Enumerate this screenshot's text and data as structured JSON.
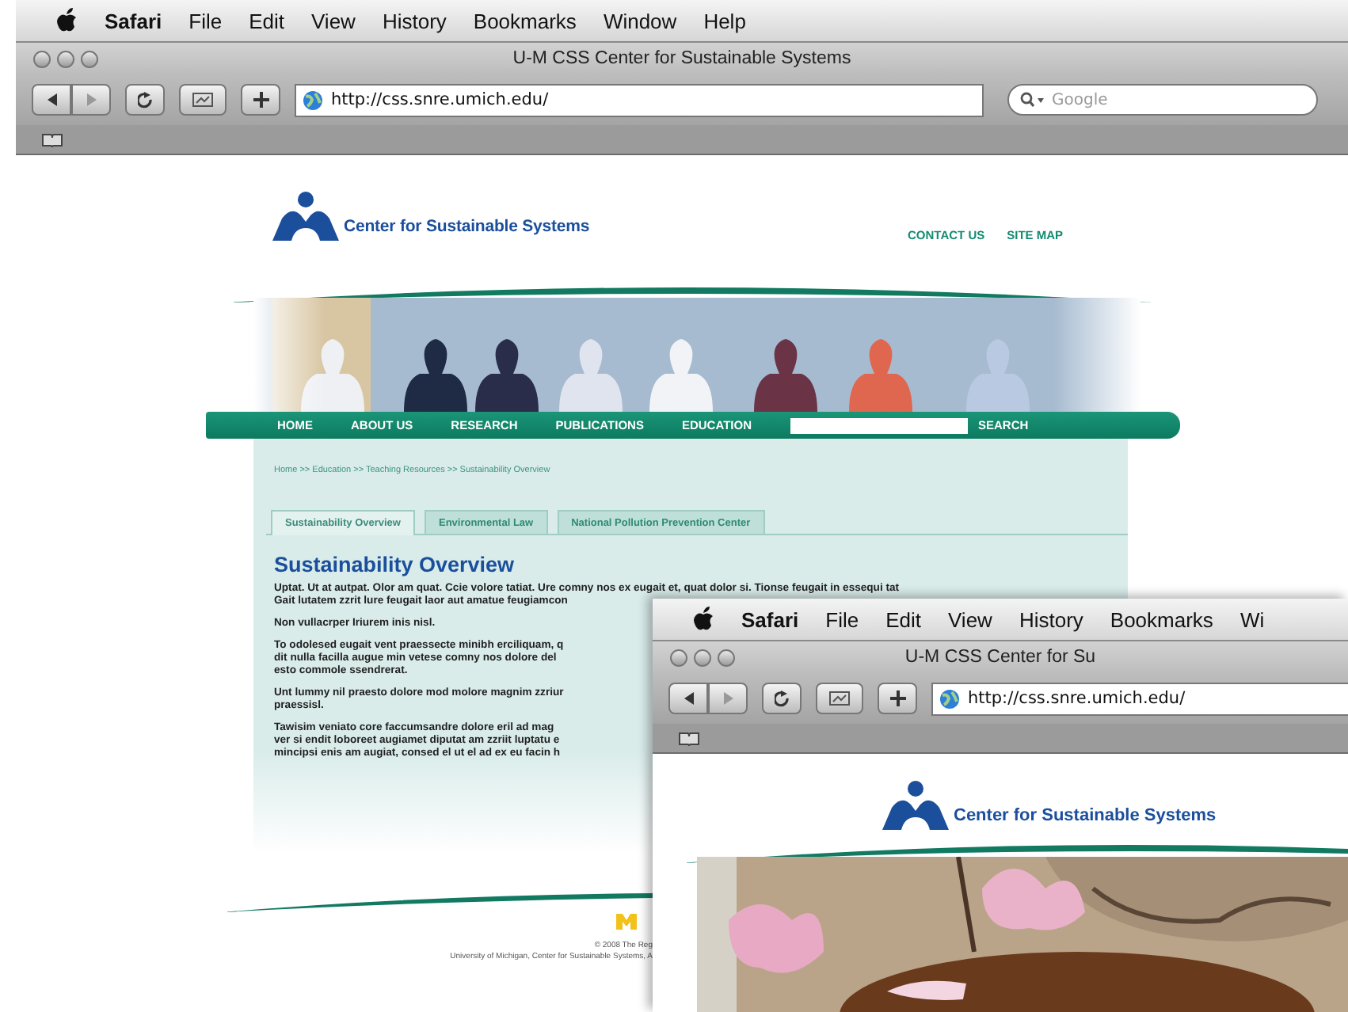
{
  "menu_bar": {
    "items": [
      "Safari",
      "File",
      "Edit",
      "View",
      "History",
      "Bookmarks",
      "Window",
      "Help"
    ]
  },
  "window": {
    "title": "U-M CSS Center for Sustainable Systems",
    "url": "http://css.snre.umich.edu/",
    "search": {
      "placeholder": "Google"
    }
  },
  "page": {
    "logo_text": "Center for Sustainable Systems",
    "top_links": [
      "CONTACT US",
      "SITE MAP"
    ],
    "nav": [
      "HOME",
      "ABOUT US",
      "RESEARCH",
      "PUBLICATIONS",
      "EDUCATION"
    ],
    "search_button": "SEARCH",
    "breadcrumb": "Home >> Education >> Teaching Resources >> Sustainability Overview",
    "tabs": [
      {
        "label": "Sustainability Overview",
        "selected": true
      },
      {
        "label": "Environmental Law",
        "selected": false
      },
      {
        "label": "National Pollution Prevention Center",
        "selected": false
      }
    ],
    "heading": "Sustainability Overview",
    "paragraphs": [
      [
        "Uptat. Ut at autpat. Olor am quat. Ccie volore tatiat. Ure comny nos ex eugait et, quat dolor si. Tionse feugait in essequi tat",
        "Gait lutatem zzrit lure feugait laor aut amatue feugiamcon"
      ],
      [
        "Non vullacrper Iriurem inis nisl."
      ],
      [
        "To odolesed eugait vent praessecte minibh erciliquam, q",
        "dit nulla facilla augue min vetese comny nos dolore del",
        "esto commole ssendrerat."
      ],
      [
        "Unt lummy nil praesto dolore mod molore magnim zzriur",
        "praessisl."
      ],
      [
        "Tawisim veniato core faccumsandre dolore eril ad mag",
        "ver si endit loboreet augiamet diputat am zzriit luptatu e",
        "mincipsi enis am augiat, consed el ut el ad ex eu facin h"
      ]
    ],
    "footer": [
      "© 2008 The Reg",
      "University of Michigan, Center for Sustainable Systems, A"
    ]
  },
  "second_window": {
    "menu_bar": {
      "items": [
        "Safari",
        "File",
        "Edit",
        "View",
        "History",
        "Bookmarks",
        "Wi"
      ]
    },
    "title": "U-M CSS Center for Su",
    "url": "http://css.snre.umich.edu/",
    "logo_text": "Center for Sustainable Systems"
  }
}
